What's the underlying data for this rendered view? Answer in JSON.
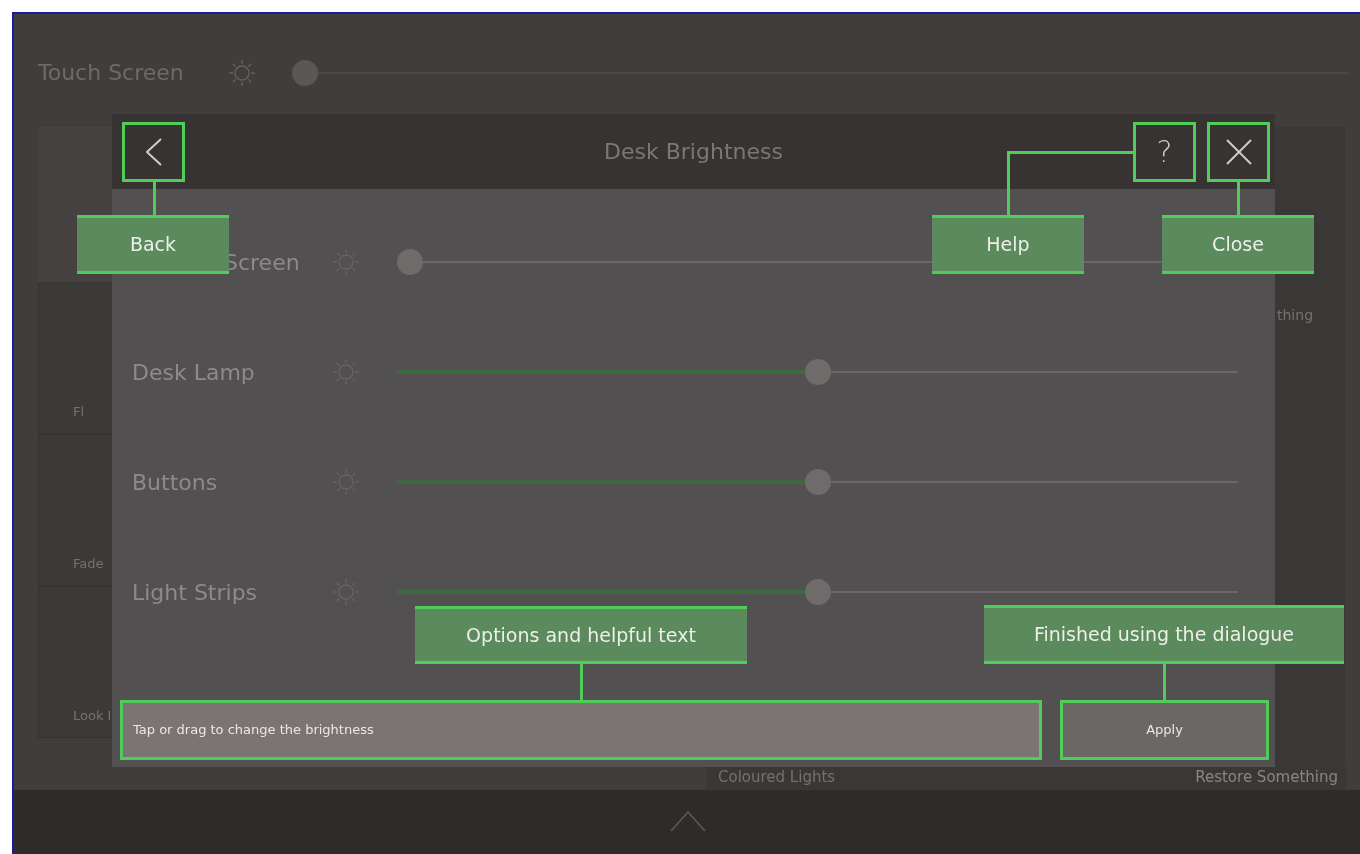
{
  "background": {
    "top_row": {
      "label": "Touch Screen",
      "level": 0
    },
    "tiles": [
      {
        "label": "Fl"
      },
      {
        "label": "Fade"
      },
      {
        "label": "Look I"
      }
    ],
    "side_items": [
      {
        "label": "thing"
      }
    ],
    "footer_items": [
      {
        "label": "Coloured Lights"
      },
      {
        "label": "Restore Something"
      }
    ]
  },
  "dialog": {
    "title": "Desk Brightness",
    "help_button": "?",
    "rows": [
      {
        "label": "Screen",
        "kind": "partly_hidden",
        "level": 0
      },
      {
        "label": "Desk Lamp",
        "kind": "full",
        "level": 0.5
      },
      {
        "label": "Buttons",
        "kind": "full",
        "level": 0.5
      },
      {
        "label": "Light Strips",
        "kind": "full",
        "level": 0.5
      }
    ],
    "hint": "Tap or drag to change the brightness",
    "apply_button": "Apply"
  },
  "callouts": [
    {
      "kind": "back",
      "text": "Back"
    },
    {
      "kind": "help",
      "text": "Help"
    },
    {
      "kind": "close",
      "text": "Close"
    },
    {
      "kind": "options",
      "text": "Options and helpful text"
    },
    {
      "kind": "finish",
      "text": "Finished using the dialogue"
    }
  ]
}
